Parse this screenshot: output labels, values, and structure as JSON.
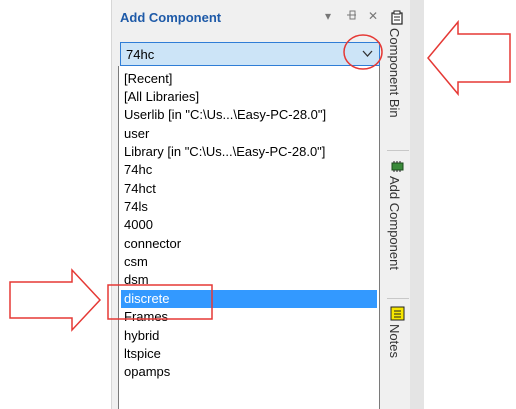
{
  "panel": {
    "title": "Add Component",
    "combo_value": "74hc"
  },
  "list_items": [
    "[Recent]",
    "[All Libraries]",
    "Userlib   [in \"C:\\Us...\\Easy-PC-28.0\"]",
    "user",
    "Library   [in \"C:\\Us...\\Easy-PC-28.0\"]",
    "74hc",
    "74hct",
    "74ls",
    "4000",
    "connector",
    "csm",
    "discrete",
    "dsm",
    "Frames",
    "hybrid",
    "ltspice",
    "opamps"
  ],
  "selected_index": 11,
  "right_tabs": {
    "component_bin": "Component Bin",
    "add_component": "Add Component",
    "notes": "Notes"
  },
  "colors": {
    "accent": "#2f7dd6",
    "selection": "#3399ff",
    "annotation": "#e53935"
  }
}
